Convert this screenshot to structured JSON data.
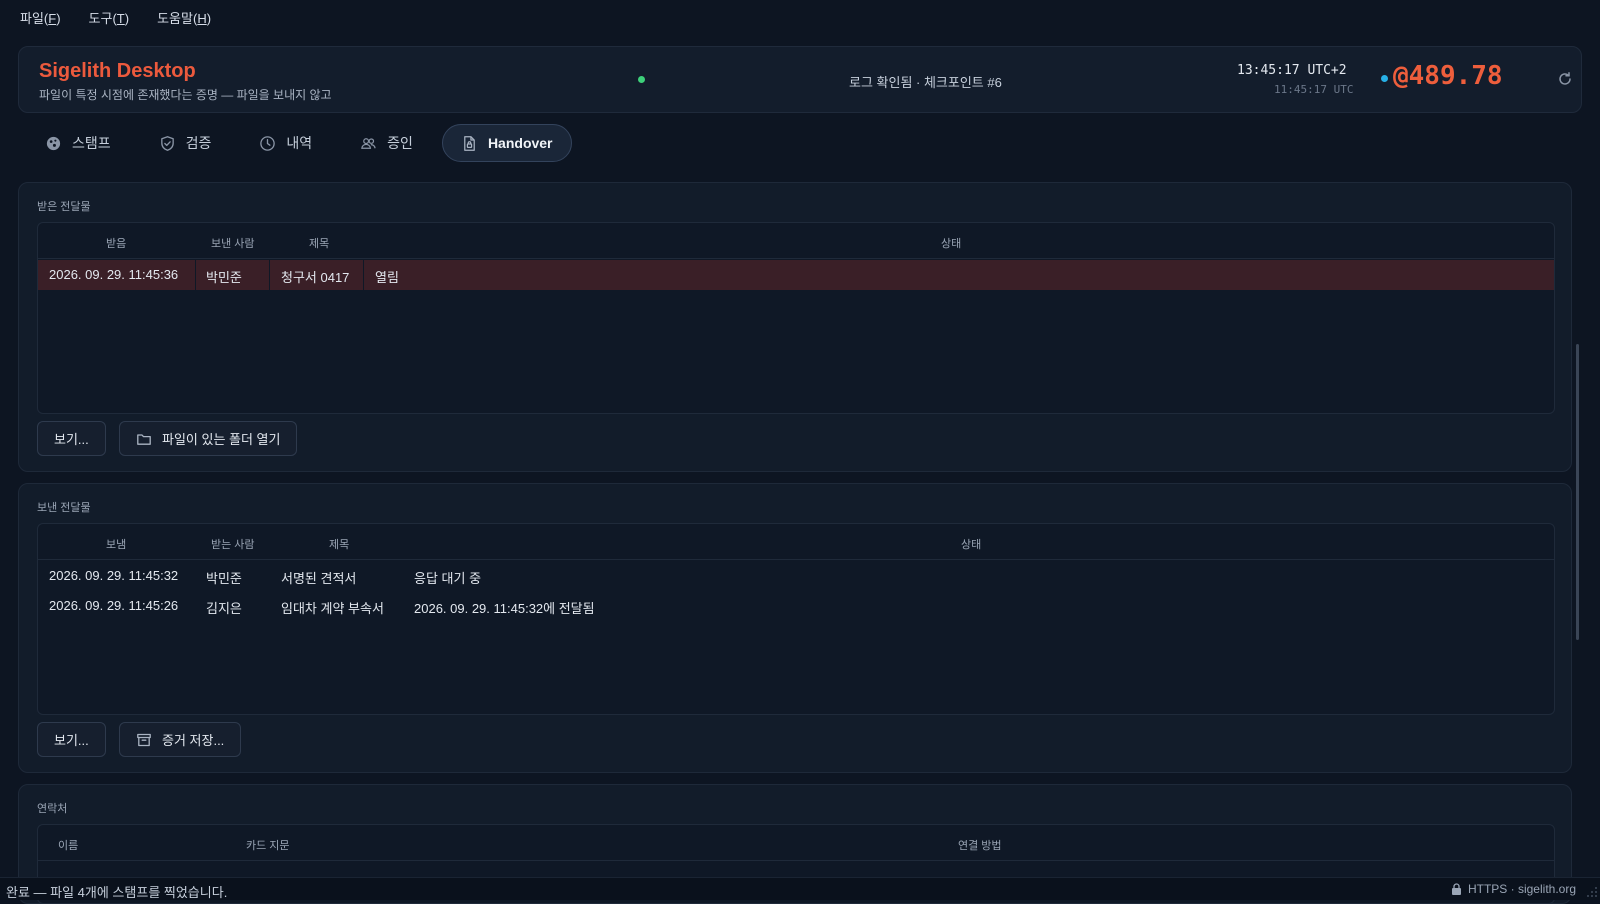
{
  "menu": {
    "items": [
      {
        "label": "파일(",
        "key": "F",
        "suffix": ")"
      },
      {
        "label": "도구(",
        "key": "T",
        "suffix": ")"
      },
      {
        "label": "도움말(",
        "key": "H",
        "suffix": ")"
      }
    ]
  },
  "header": {
    "title": "Sigelith Desktop",
    "subtitle": "파일이 특정 시점에 존재했다는 증명 — 파일을 보내지 않고",
    "log_status": "로그 확인됨 · 체크포인트 #6",
    "clock_time": "13:45:17  UTC+2",
    "clock_utc": "11:45:17 UTC",
    "height_value": "@489.78",
    "colors": {
      "accent": "#ec5a3d",
      "ok": "#3dd07a",
      "sync": "#27b0e6"
    }
  },
  "tabs": [
    {
      "label": "스탬프",
      "icon": "stamp-icon"
    },
    {
      "label": "검증",
      "icon": "shield-icon"
    },
    {
      "label": "내역",
      "icon": "clock-icon"
    },
    {
      "label": "증인",
      "icon": "people-icon"
    },
    {
      "label": "Handover",
      "icon": "file-lock-icon",
      "active": true
    }
  ],
  "received": {
    "title": "받은 전달물",
    "columns": [
      "받음",
      "보낸 사람",
      "제목",
      "상태"
    ],
    "rows": [
      {
        "date": "2026. 09. 29. 11:45:36",
        "person": "박민준",
        "subject": "청구서 0417",
        "status": "열림",
        "selected": true
      }
    ],
    "view_button": "보기...",
    "open_folder_button": "파일이 있는 폴더 열기"
  },
  "sent": {
    "title": "보낸 전달물",
    "columns": [
      "보냄",
      "받는 사람",
      "제목",
      "상태"
    ],
    "rows": [
      {
        "date": "2026. 09. 29. 11:45:32",
        "person": "박민준",
        "subject": "서명된 견적서",
        "status": "응답 대기 중"
      },
      {
        "date": "2026. 09. 29. 11:45:26",
        "person": "김지은",
        "subject": "임대차 계약 부속서",
        "status": "2026. 09. 29. 11:45:32에 전달됨"
      }
    ],
    "view_button": "보기...",
    "save_evidence_button": "증거 저장..."
  },
  "contacts": {
    "title": "연락처",
    "columns": [
      "이름",
      "카드 지문",
      "연결 방법"
    ]
  },
  "statusbar": {
    "text": "완료 — 파일 4개에 스탬프를 찍었습니다.",
    "right": "HTTPS · sigelith.org"
  }
}
